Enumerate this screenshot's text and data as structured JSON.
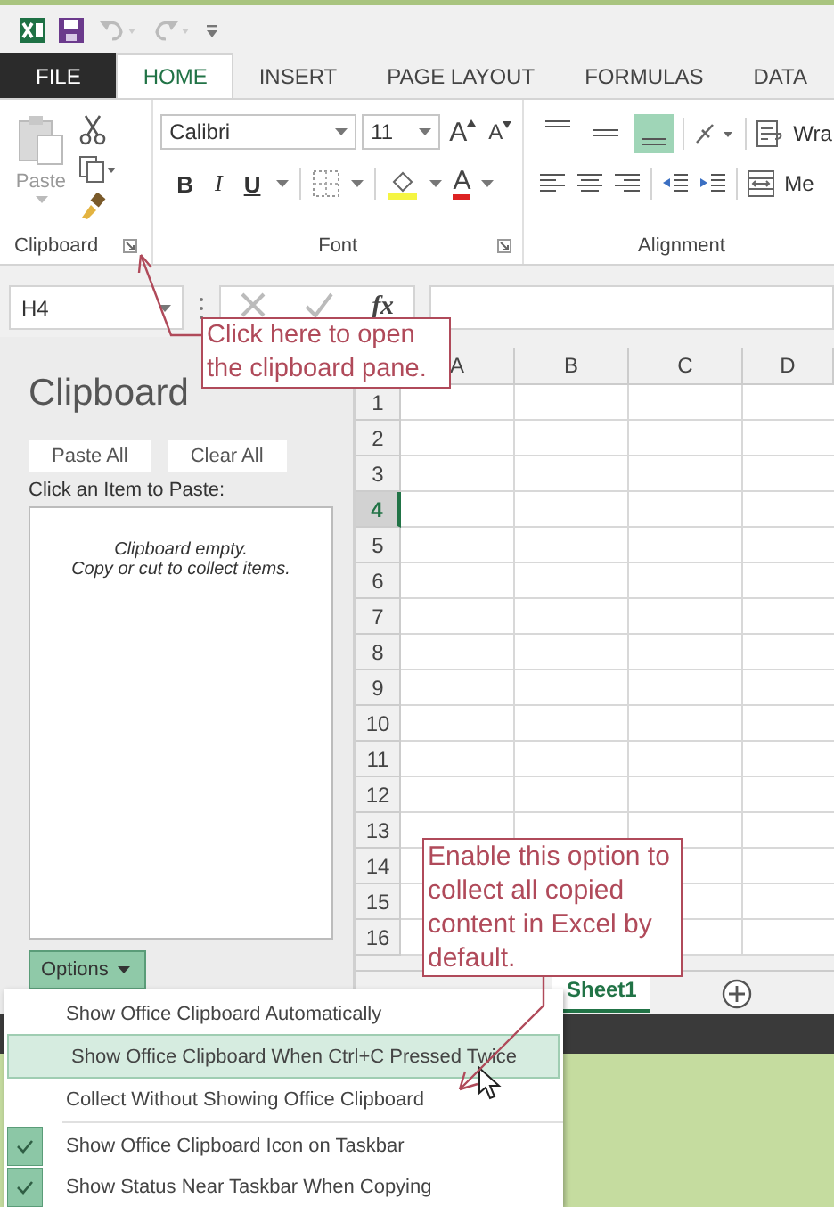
{
  "ribbon_tabs": [
    {
      "label": "FILE",
      "kind": "file",
      "selected": false
    },
    {
      "label": "HOME",
      "kind": "tab",
      "selected": true
    },
    {
      "label": "INSERT",
      "kind": "tab",
      "selected": false
    },
    {
      "label": "PAGE LAYOUT",
      "kind": "tab",
      "selected": false
    },
    {
      "label": "FORMULAS",
      "kind": "tab",
      "selected": false
    },
    {
      "label": "DATA",
      "kind": "tab",
      "selected": false
    }
  ],
  "ribbon": {
    "clipboard": {
      "paste_label": "Paste",
      "group_label": "Clipboard"
    },
    "font": {
      "font_name": "Calibri",
      "font_size": "11",
      "size_buttons": [
        "A",
        "A"
      ],
      "format_buttons": [
        "B",
        "I",
        "U"
      ],
      "font_color_label": "A",
      "group_label": "Font"
    },
    "alignment": {
      "vertical_alignment": [
        {
          "selected": false
        },
        {
          "selected": false
        },
        {
          "selected": true
        }
      ],
      "wrap_label": "Wra",
      "merge_label": "Me",
      "group_label": "Alignment"
    }
  },
  "formula_bar": {
    "name_box": "H4",
    "function_label": "fx"
  },
  "clipboard_pane": {
    "title": "Clipboard",
    "buttons": [
      "Paste All",
      "Clear All"
    ],
    "prompt": "Click an Item to Paste:",
    "empty_message": [
      "Clipboard empty.",
      "Copy or cut to collect items."
    ],
    "options_button": "Options"
  },
  "sheet": {
    "columns": [
      "A",
      "B",
      "C",
      "D"
    ],
    "rows": [
      {
        "label": "1",
        "selected": false
      },
      {
        "label": "2",
        "selected": false
      },
      {
        "label": "3",
        "selected": false
      },
      {
        "label": "4",
        "selected": true
      },
      {
        "label": "5",
        "selected": false
      },
      {
        "label": "6",
        "selected": false
      },
      {
        "label": "7",
        "selected": false
      },
      {
        "label": "8",
        "selected": false
      },
      {
        "label": "9",
        "selected": false
      },
      {
        "label": "10",
        "selected": false
      },
      {
        "label": "11",
        "selected": false
      },
      {
        "label": "12",
        "selected": false
      },
      {
        "label": "13",
        "selected": false
      },
      {
        "label": "14",
        "selected": false
      },
      {
        "label": "15",
        "selected": false
      },
      {
        "label": "16",
        "selected": false
      }
    ],
    "sheet_tabs": [
      {
        "label": "Sheet1",
        "selected": true
      }
    ]
  },
  "options_menu": [
    {
      "label": "Show Office Clipboard Automatically",
      "checked": false,
      "selected": false
    },
    {
      "label": "Show Office Clipboard When Ctrl+C Pressed Twice",
      "checked": false,
      "selected": true
    },
    {
      "label": "Collect Without Showing Office Clipboard",
      "checked": false,
      "selected": false
    },
    {
      "label": "Show Office Clipboard Icon on Taskbar",
      "checked": true,
      "selected": false
    },
    {
      "label": "Show Status Near Taskbar When Copying",
      "checked": true,
      "selected": false
    }
  ],
  "callouts": [
    {
      "text": "Click here to open the clipboard pane."
    },
    {
      "text": "Enable this option to collect all copied content in Excel by default."
    }
  ]
}
